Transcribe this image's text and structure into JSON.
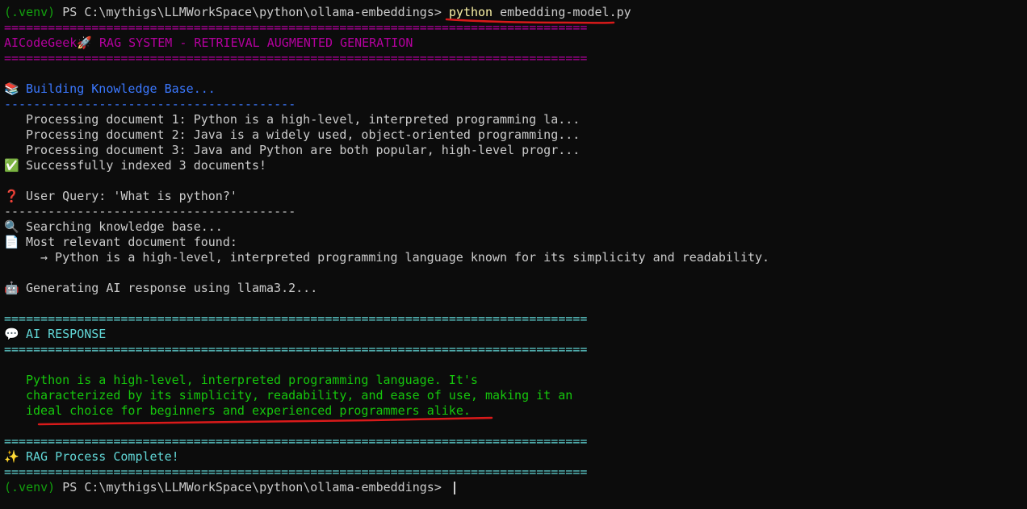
{
  "prompt": {
    "venv": "(.venv)",
    "ps_path": " PS C:\\mythigs\\LLMWorkSpace\\python\\ollama-embeddings> ",
    "cmd_exe": "python",
    "cmd_args": " embedding-model.py"
  },
  "banner": {
    "rule_eq": "================================================================================",
    "title_brand": "AICodeGeek",
    "title_icon": "🚀",
    "title_text": " RAG SYSTEM - RETRIEVAL AUGMENTED GENERATION"
  },
  "kb": {
    "icon": "📚",
    "heading": "Building Knowledge Base...",
    "rule_dash": "----------------------------------------",
    "docs": [
      "Processing document 1: Python is a high-level, interpreted programming la...",
      "Processing document 2: Java is a widely used, object-oriented programming...",
      "Processing document 3: Java and Python are both popular, high-level progr..."
    ],
    "success_icon": "✅",
    "success_text": "Successfully indexed 3 documents!"
  },
  "query": {
    "icon": "❓",
    "text": "User Query: 'What is python?'",
    "rule_dash": "----------------------------------------",
    "search_icon": "🔍",
    "search_text": "Searching knowledge base...",
    "doc_icon": "📄",
    "found_text": "Most relevant document found:",
    "result": "→ Python is a high-level, interpreted programming language known for its simplicity and readability."
  },
  "generate": {
    "icon": "🤖",
    "text": "Generating AI response using llama3.2..."
  },
  "response": {
    "rule_eq": "================================================================================",
    "icon": "💬",
    "heading": "AI RESPONSE",
    "lines": [
      "Python is a high-level, interpreted programming language. It's",
      "characterized by its simplicity, readability, and ease of use, making it an",
      "ideal choice for beginners and experienced programmers alike."
    ]
  },
  "complete": {
    "icon": "✨",
    "text": "RAG Process Complete!"
  },
  "colors": {
    "background": "#0c0c0c",
    "prompt_green": "#13a10e",
    "magenta": "#b4009e",
    "blue": "#3b78ff",
    "cyan": "#61d6d6",
    "ai_green": "#16c60c",
    "annotation_red": "#d91a1a"
  }
}
